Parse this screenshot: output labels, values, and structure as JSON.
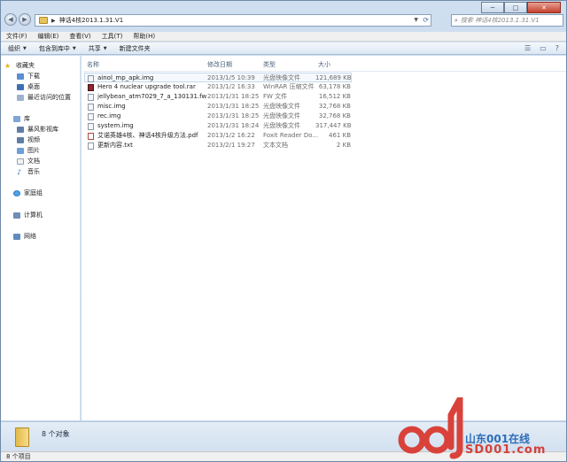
{
  "window": {
    "breadcrumb": "神话4核2013.1.31.V1",
    "search_placeholder": "搜索 神话4核2013.1.31.V1",
    "min_label": "─",
    "max_label": "□",
    "close_label": "✕"
  },
  "menu": [
    "文件(F)",
    "编辑(E)",
    "查看(V)",
    "工具(T)",
    "帮助(H)"
  ],
  "toolbar": {
    "organize": "组织",
    "include_in_library": "包含到库中",
    "share": "共享",
    "new_folder": "新建文件夹"
  },
  "nav": {
    "favorites": "收藏夹",
    "downloads": "下载",
    "desktop": "桌面",
    "recent": "最近访问的位置",
    "libraries": "库",
    "baofeng": "暴风影视库",
    "videos": "视频",
    "pictures": "图片",
    "documents": "文档",
    "music": "音乐",
    "homegroup": "家庭组",
    "computer": "计算机",
    "network": "网络"
  },
  "columns": {
    "name": "名称",
    "date": "修改日期",
    "type": "类型",
    "size": "大小"
  },
  "files": [
    {
      "name": "ainol_mp_apk.img",
      "date": "2013/1/5 10:39",
      "type": "光盘映像文件",
      "size": "121,689 KB"
    },
    {
      "name": "Hero 4 nuclear upgrade tool.rar",
      "date": "2013/1/2 16:33",
      "type": "WinRAR 压缩文件",
      "size": "63,178 KB"
    },
    {
      "name": "jellybean_atm7029_7_a_130131.fw",
      "date": "2013/1/31 18:25",
      "type": "FW 文件",
      "size": "16,512 KB"
    },
    {
      "name": "misc.img",
      "date": "2013/1/31 18:25",
      "type": "光盘映像文件",
      "size": "32,768 KB"
    },
    {
      "name": "rec.img",
      "date": "2013/1/31 18:25",
      "type": "光盘映像文件",
      "size": "32,768 KB"
    },
    {
      "name": "system.img",
      "date": "2013/1/31 18:24",
      "type": "光盘映像文件",
      "size": "317,447 KB"
    },
    {
      "name": "艾诺英雄4核、神话4核升级方法.pdf",
      "date": "2013/1/2 16:22",
      "type": "Foxit Reader Do...",
      "size": "461 KB"
    },
    {
      "name": "更新内容.txt",
      "date": "2013/2/1 19:27",
      "type": "文本文档",
      "size": "2 KB"
    }
  ],
  "details": {
    "count": "8 个对象"
  },
  "status": {
    "text": "8 个项目"
  },
  "watermark": {
    "line1": "山东001在线",
    "line2": "SD001.com"
  }
}
